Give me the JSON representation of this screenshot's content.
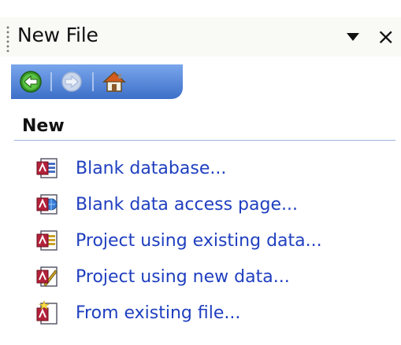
{
  "pane": {
    "title": "New File",
    "dropdown_icon": "triangle-down-icon",
    "close_label": "×"
  },
  "toolbar": {
    "back_icon": "back-arrow-icon",
    "forward_icon": "forward-arrow-icon",
    "home_icon": "home-icon"
  },
  "section": {
    "heading": "New",
    "items": [
      {
        "label": "Blank database...",
        "icon": "database-icon"
      },
      {
        "label": "Blank data access page...",
        "icon": "data-access-page-icon"
      },
      {
        "label": "Project using existing data...",
        "icon": "project-existing-data-icon"
      },
      {
        "label": "Project using new data...",
        "icon": "project-new-data-icon"
      },
      {
        "label": "From existing file...",
        "icon": "existing-file-icon"
      }
    ]
  },
  "colors": {
    "link": "#1f3fbf",
    "toolbar": "#4a7fd4",
    "rule": "#9cb4dc"
  }
}
